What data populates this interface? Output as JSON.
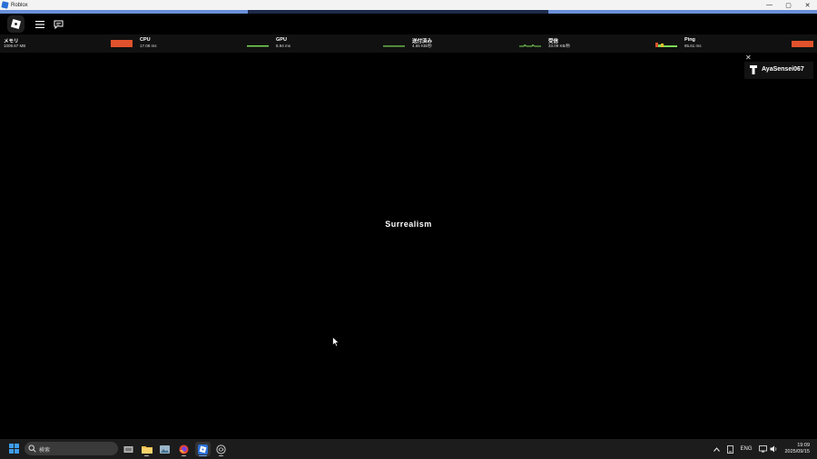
{
  "window": {
    "title": "Roblox",
    "minimize": "—",
    "maximize": "▢",
    "close": "✕"
  },
  "stats": [
    {
      "label": "メモリ",
      "value": "1009.67 MB",
      "graph_color": "#e0522b"
    },
    {
      "label": "CPU",
      "value": "17.08 ms",
      "graph_color": "#7ed957"
    },
    {
      "label": "GPU",
      "value": "8.94 ms",
      "graph_color": "#7ed957"
    },
    {
      "label": "送付済み",
      "value": "4.65 KB/秒",
      "graph_color": "#7ed957"
    },
    {
      "label": "受信",
      "value": "33.09 KB/秒",
      "graph_color": "#e0522b"
    },
    {
      "label": "Ping",
      "value": "85.61 ms",
      "graph_color": "#e0522b"
    }
  ],
  "player": {
    "name": "AyaSensei067",
    "close": "✕"
  },
  "center_title": "Surrealism",
  "taskbar": {
    "search_placeholder": "検索",
    "lang": "ENG",
    "time": "19:09",
    "date": "2025/09/15"
  },
  "colors": {
    "accent": "#2a6fd6",
    "progress": "#6a8fd8",
    "stat_bad": "#e0522b",
    "stat_good": "#7ed957"
  }
}
